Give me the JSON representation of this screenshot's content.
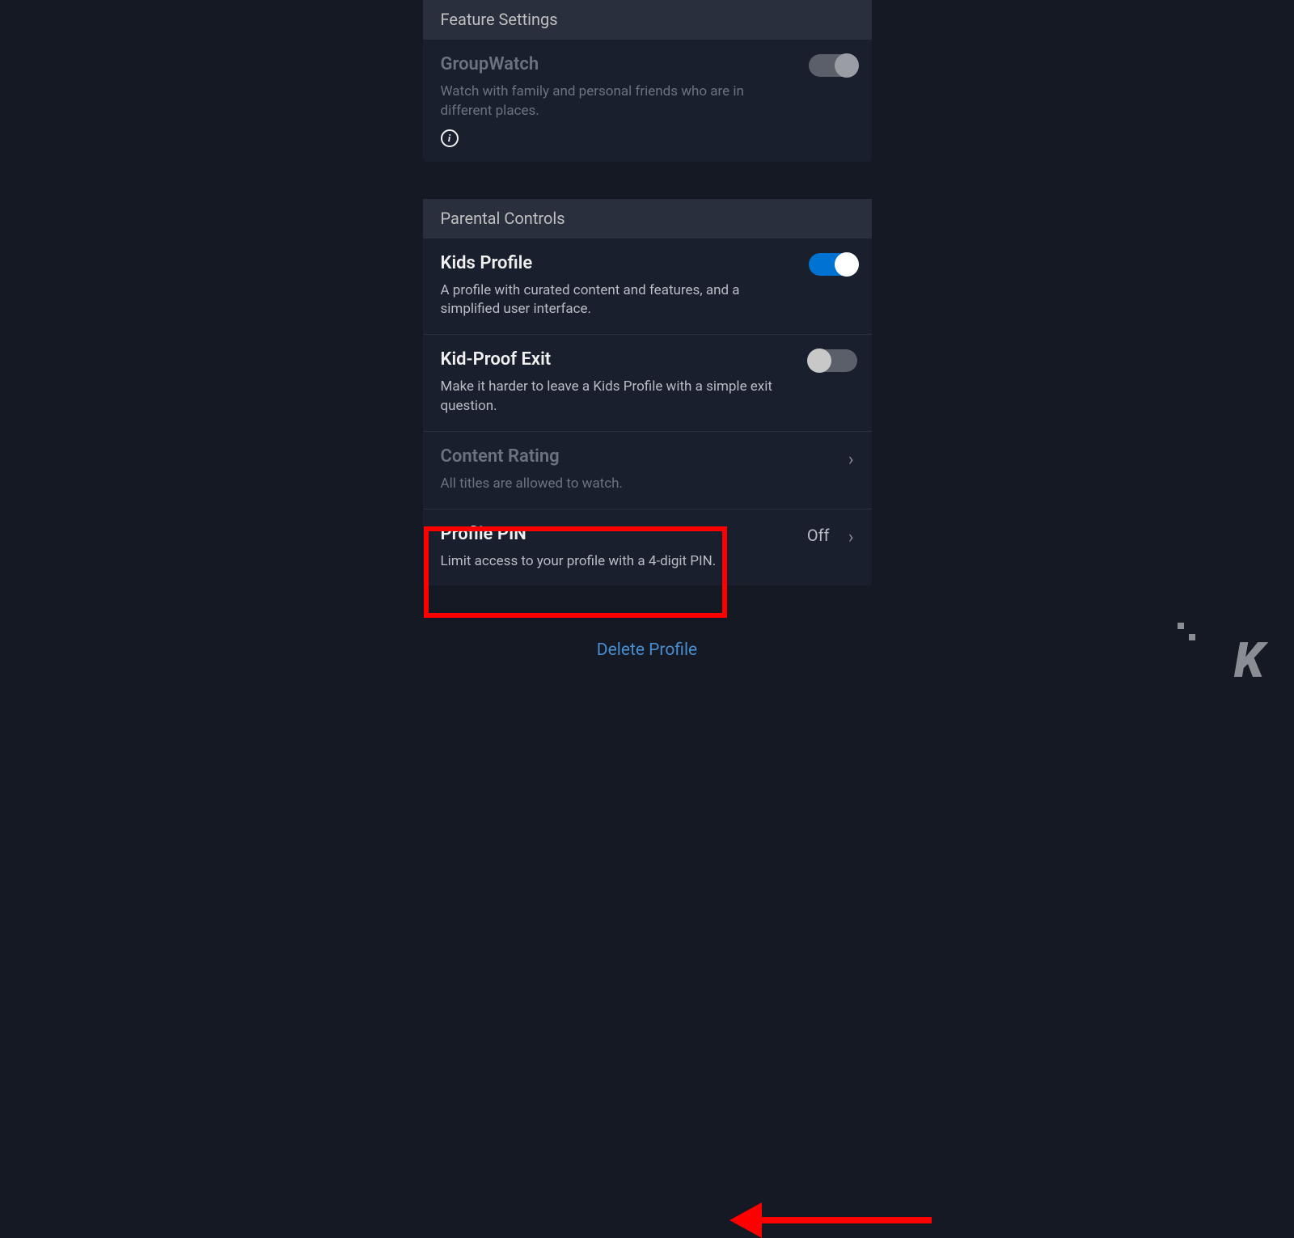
{
  "feature_settings": {
    "header": "Feature Settings",
    "groupwatch": {
      "title": "GroupWatch",
      "desc": "Watch with family and personal friends who are in different places."
    }
  },
  "parental_controls": {
    "header": "Parental Controls",
    "kids_profile": {
      "title": "Kids Profile",
      "desc": "A profile with curated content and features, and a simplified user interface."
    },
    "kid_proof_exit": {
      "title": "Kid-Proof Exit",
      "desc": "Make it harder to leave a Kids Profile with a simple exit question."
    },
    "content_rating": {
      "title": "Content Rating",
      "desc": "All titles are allowed to watch."
    },
    "profile_pin": {
      "title": "Profile PIN",
      "desc": "Limit access to your profile with a 4-digit PIN.",
      "value": "Off"
    }
  },
  "delete_profile": "Delete Profile",
  "info_glyph": "i",
  "chevron_glyph": "›",
  "watermark": "K"
}
